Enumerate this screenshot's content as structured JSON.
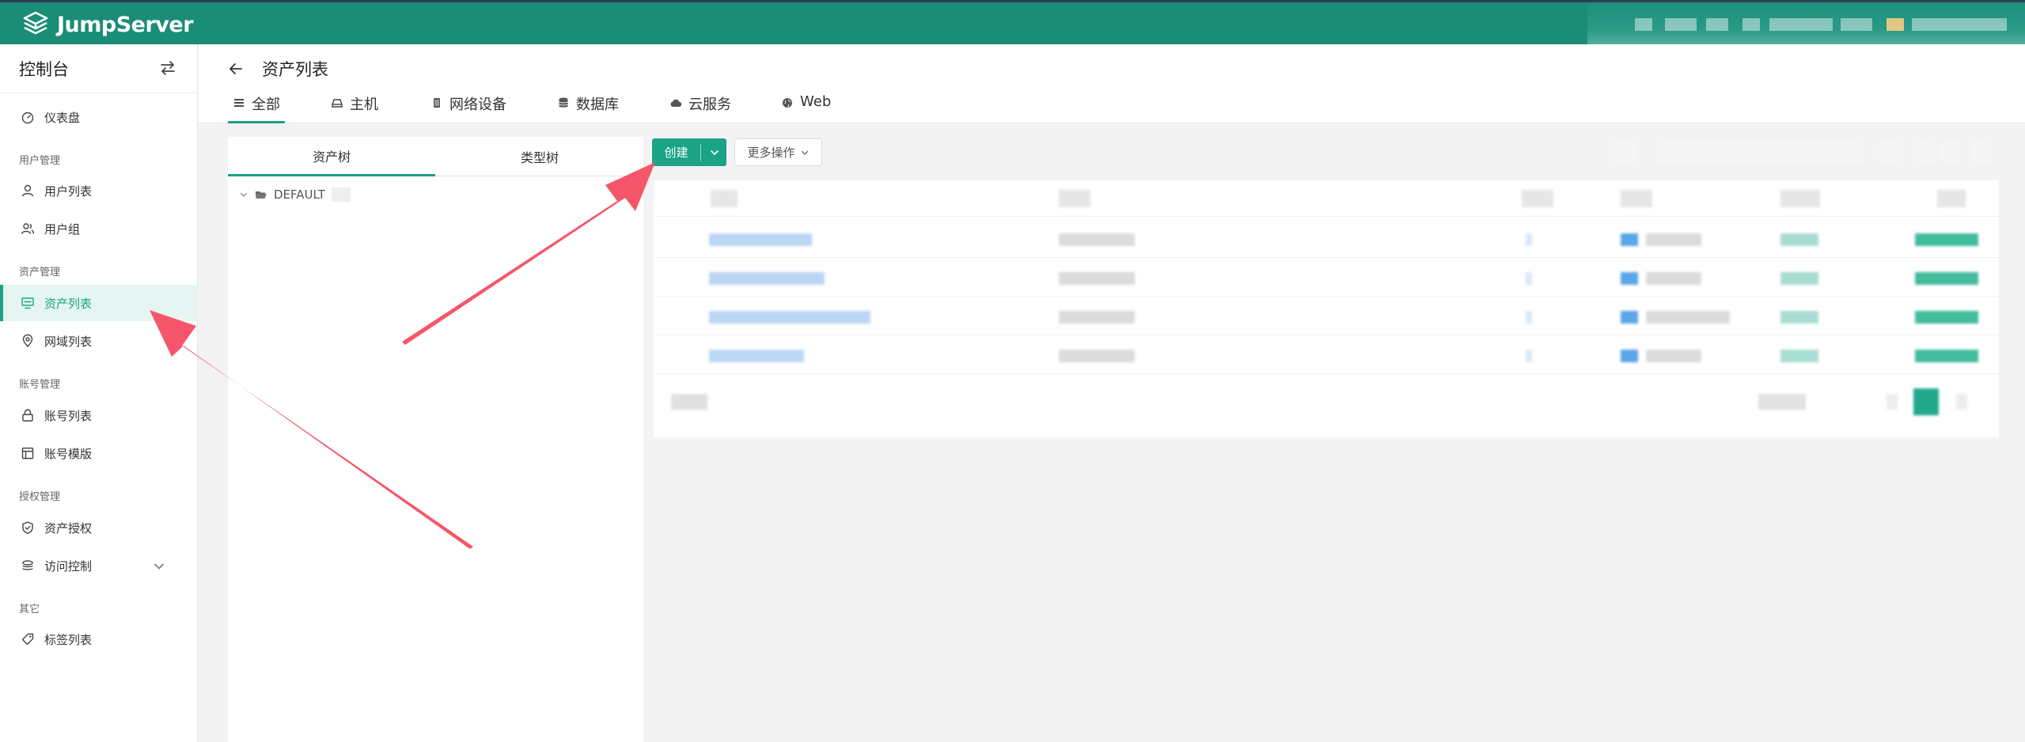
{
  "brand": {
    "name": "JumpServer"
  },
  "sidebar": {
    "title": "控制台",
    "items": [
      {
        "key": "dashboard",
        "label": "仪表盘",
        "icon": "dashboard-icon"
      },
      {
        "key": "users",
        "label": "用户列表",
        "icon": "user-icon",
        "group": "用户管理"
      },
      {
        "key": "user-groups",
        "label": "用户组",
        "icon": "user-group-icon"
      },
      {
        "key": "assets",
        "label": "资产列表",
        "icon": "asset-list-icon",
        "group": "资产管理",
        "active": true
      },
      {
        "key": "zones",
        "label": "网域列表",
        "icon": "zone-icon"
      },
      {
        "key": "accounts",
        "label": "账号列表",
        "icon": "lock-icon",
        "group": "账号管理"
      },
      {
        "key": "templates",
        "label": "账号模版",
        "icon": "template-icon"
      },
      {
        "key": "permissions",
        "label": "资产授权",
        "icon": "shield-icon",
        "group": "授权管理"
      },
      {
        "key": "acl",
        "label": "访问控制",
        "icon": "access-control-icon",
        "expandable": true
      },
      {
        "key": "labels",
        "label": "标签列表",
        "icon": "tag-icon",
        "group": "其它"
      }
    ],
    "groups": [
      "用户管理",
      "资产管理",
      "账号管理",
      "授权管理",
      "其它"
    ]
  },
  "page": {
    "title": "资产列表",
    "tabs": [
      {
        "key": "all",
        "label": "全部",
        "icon": "list-icon",
        "active": true
      },
      {
        "key": "host",
        "label": "主机",
        "icon": "host-icon"
      },
      {
        "key": "network",
        "label": "网络设备",
        "icon": "network-device-icon"
      },
      {
        "key": "database",
        "label": "数据库",
        "icon": "database-icon"
      },
      {
        "key": "cloud",
        "label": "云服务",
        "icon": "cloud-icon"
      },
      {
        "key": "web",
        "label": "Web",
        "icon": "globe-icon"
      }
    ]
  },
  "tree": {
    "tabs": [
      {
        "label": "资产树",
        "active": true
      },
      {
        "label": "类型树"
      }
    ],
    "root": {
      "label": "DEFAULT"
    }
  },
  "toolbar": {
    "create_label": "创建",
    "more_label": "更多操作"
  },
  "colors": {
    "header": "#1a8d77",
    "accent": "#1aa384",
    "active_bg": "#e6f5f1",
    "annotation_arrow": "#f5566a"
  }
}
